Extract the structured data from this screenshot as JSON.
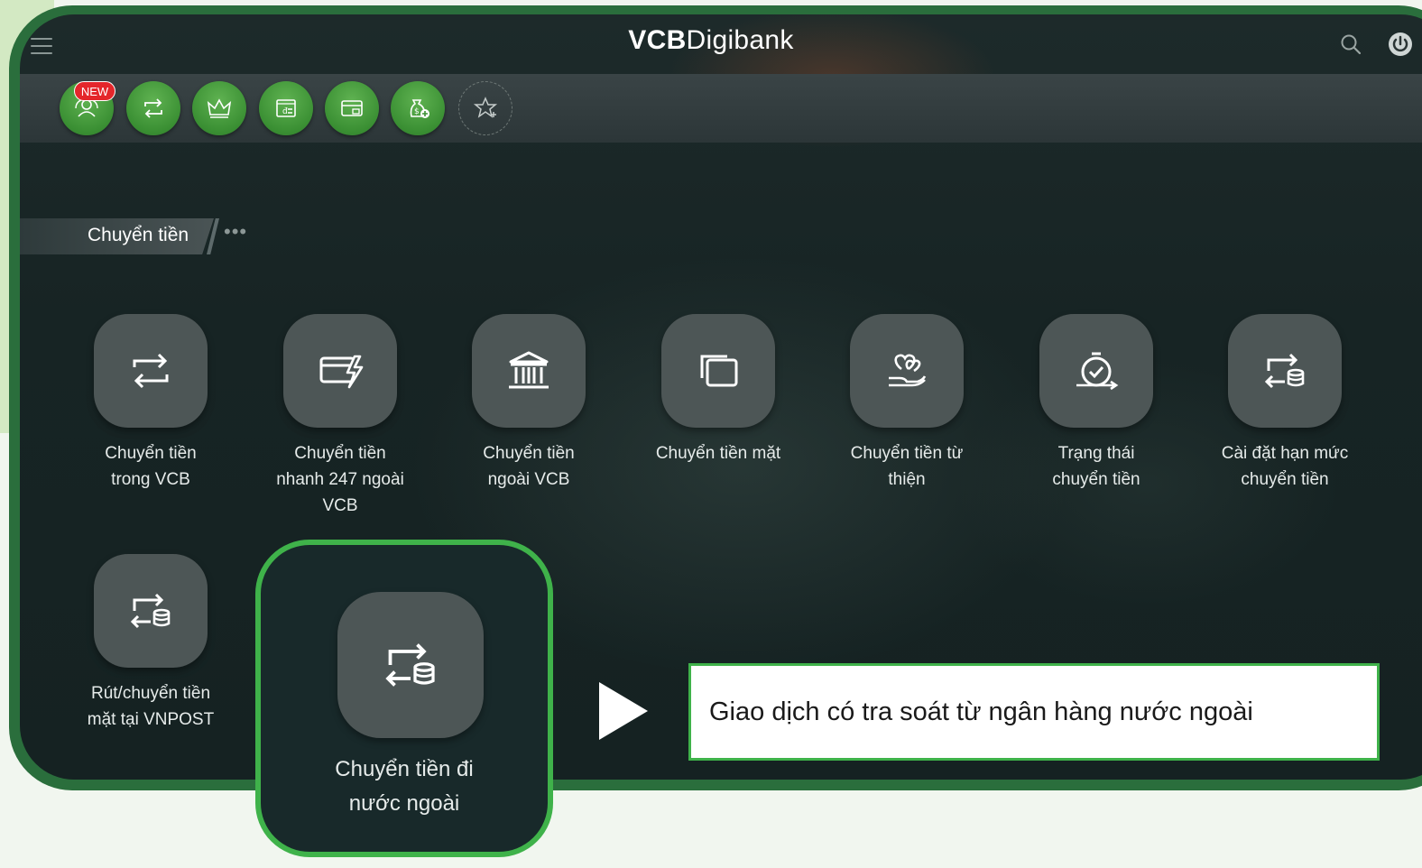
{
  "app": {
    "title_part1": "VCB",
    "title_part2": "Digibank"
  },
  "header_icons": [
    "menu-icon",
    "search-icon",
    "power-icon"
  ],
  "quick_actions": {
    "badge": "NEW",
    "items": [
      "gift-support-icon",
      "transfer-icon",
      "crown-icon",
      "bill-icon",
      "card-icon",
      "savings-icon",
      "add-favorite-icon"
    ]
  },
  "section": {
    "title": "Chuyển tiền",
    "more": "•••"
  },
  "services": [
    {
      "label_1": "Chuyển tiền",
      "label_2": "trong VCB",
      "label_3": "",
      "icon": "transfer-arrows-icon"
    },
    {
      "label_1": "Chuyển tiền",
      "label_2": "nhanh 247 ngoài",
      "label_3": "VCB",
      "icon": "fast-card-icon"
    },
    {
      "label_1": "Chuyển tiền",
      "label_2": "ngoài VCB",
      "label_3": "",
      "icon": "bank-icon"
    },
    {
      "label_1": "Chuyển tiền mặt",
      "label_2": "",
      "label_3": "",
      "icon": "cash-icon"
    },
    {
      "label_1": "Chuyển tiền từ",
      "label_2": "thiện",
      "label_3": "",
      "icon": "charity-icon"
    },
    {
      "label_1": "Trạng thái",
      "label_2": "chuyển tiền",
      "label_3": "",
      "icon": "status-clock-icon"
    },
    {
      "label_1": "Cài đặt hạn mức",
      "label_2": "chuyển tiền",
      "label_3": "",
      "icon": "limit-coins-icon"
    },
    {
      "label_1": "Rút/chuyển tiền",
      "label_2": "mặt tại VNPOST",
      "label_3": "",
      "icon": "vnpost-coins-icon"
    }
  ],
  "highlighted_service": {
    "label_1": "Chuyển tiền đi",
    "label_2": "nước ngoài",
    "icon": "overseas-transfer-icon",
    "color": "#3fb24a"
  },
  "callout": {
    "text": "Giao dịch có tra soát từ ngân hàng nước ngoài"
  }
}
